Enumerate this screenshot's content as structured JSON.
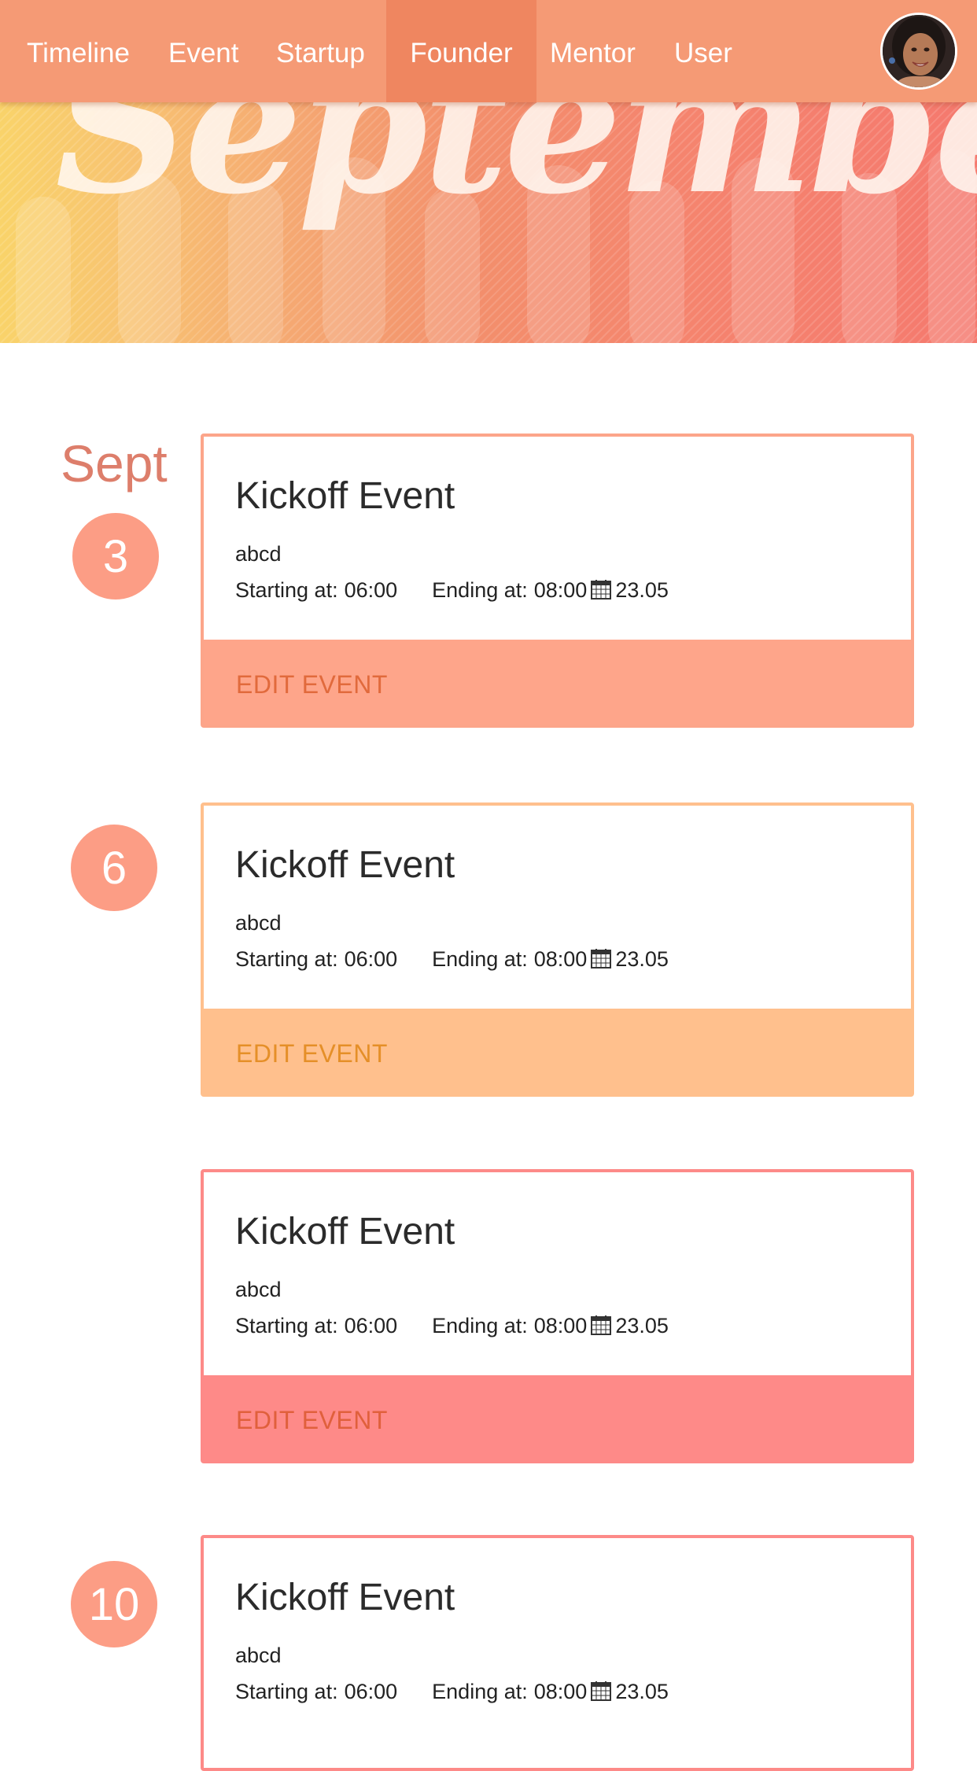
{
  "nav": {
    "items": [
      {
        "label": "Timeline",
        "active": false
      },
      {
        "label": "Event",
        "active": false
      },
      {
        "label": "Startup",
        "active": false
      },
      {
        "label": "Founder",
        "active": true
      },
      {
        "label": "Mentor",
        "active": false
      },
      {
        "label": "User",
        "active": false
      }
    ],
    "avatar_icon": "user-avatar-photo"
  },
  "banner": {
    "title": "September",
    "colors": {
      "left": "#f9d36a",
      "middle": "#f38f6c",
      "right": "#f5796e"
    }
  },
  "timeline": {
    "month": "Sept",
    "days": [
      {
        "day": "3"
      },
      {
        "day": "6"
      },
      {
        "day": "10"
      }
    ]
  },
  "events": [
    {
      "title": "Kickoff Event",
      "description": "abcd",
      "start_label": "Starting at:",
      "start_time": "06:00",
      "end_label": "Ending at:",
      "end_time": "08:00",
      "date_icon": "calendar-icon",
      "date": "23.05",
      "action_label": "EDIT EVENT",
      "colors": {
        "border": "#fca58a",
        "footer": "#fea58a",
        "action_text": "#e16a3c"
      }
    },
    {
      "title": "Kickoff Event",
      "description": "abcd",
      "start_label": "Starting at:",
      "start_time": "06:00",
      "end_label": "Ending at:",
      "end_time": "08:00",
      "date_icon": "calendar-icon",
      "date": "23.05",
      "action_label": "EDIT EVENT",
      "colors": {
        "border": "#ffc08d",
        "footer": "#ffc08d",
        "action_text": "#e58f28"
      }
    },
    {
      "title": "Kickoff Event",
      "description": "abcd",
      "start_label": "Starting at:",
      "start_time": "06:00",
      "end_label": "Ending at:",
      "end_time": "08:00",
      "date_icon": "calendar-icon",
      "date": "23.05",
      "action_label": "EDIT EVENT",
      "colors": {
        "border": "#fd8a88",
        "footer": "#fe8a88",
        "action_text": "#e0603c"
      }
    },
    {
      "title": "Kickoff Event",
      "description": "abcd",
      "start_label": "Starting at:",
      "start_time": "06:00",
      "end_label": "Ending at:",
      "end_time": "08:00",
      "date_icon": "calendar-icon",
      "date": "23.05",
      "action_label": "",
      "colors": {
        "border": "#fd8a88",
        "footer": "#fe8a88",
        "action_text": "#e0603c"
      }
    }
  ]
}
